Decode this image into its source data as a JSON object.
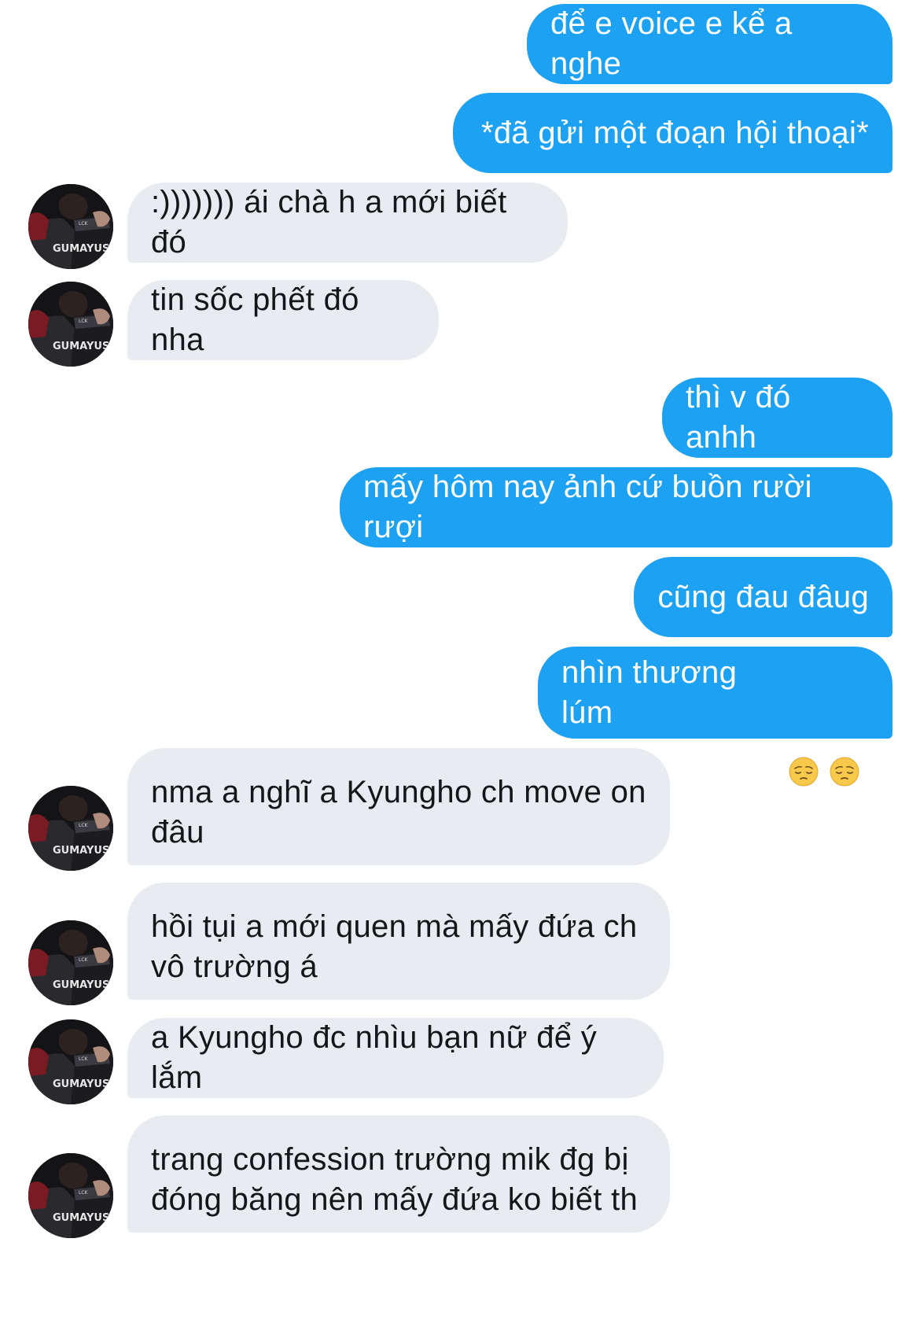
{
  "conversation": {
    "avatar_caption": "GUMAYUSI",
    "messages": [
      {
        "side": "out",
        "text": "để e voice e kể a nghe"
      },
      {
        "side": "out",
        "text": "*đã gửi một đoạn hội thoại*"
      },
      {
        "side": "in",
        "text": ":))))))) ái chà h a mới biết đó"
      },
      {
        "side": "in",
        "text": "tin sốc phết đó nha"
      },
      {
        "side": "out",
        "text": "thì v đó anhh"
      },
      {
        "side": "out",
        "text": "mấy hôm nay ảnh cứ buồn rười rượi"
      },
      {
        "side": "out",
        "text": "cũng đau đâug"
      },
      {
        "side": "out",
        "text": "nhìn thương lúm",
        "emoji": [
          "pensive-face",
          "pensive-face"
        ]
      },
      {
        "side": "in",
        "text": "nma a nghĩ a Kyungho ch move on\nđâu"
      },
      {
        "side": "in",
        "text": "hồi tụi a mới quen mà mấy đứa ch\nvô trường á"
      },
      {
        "side": "in",
        "text": "a Kyungho đc nhìu bạn nữ để ý lắm"
      },
      {
        "side": "in",
        "text": "trang confession trường mik đg bị\nđóng băng nên mấy đứa ko biết th"
      }
    ]
  },
  "colors": {
    "sent_bubble": "#1da1f2",
    "received_bubble": "#e8ecf0",
    "received_text": "#14171a"
  }
}
